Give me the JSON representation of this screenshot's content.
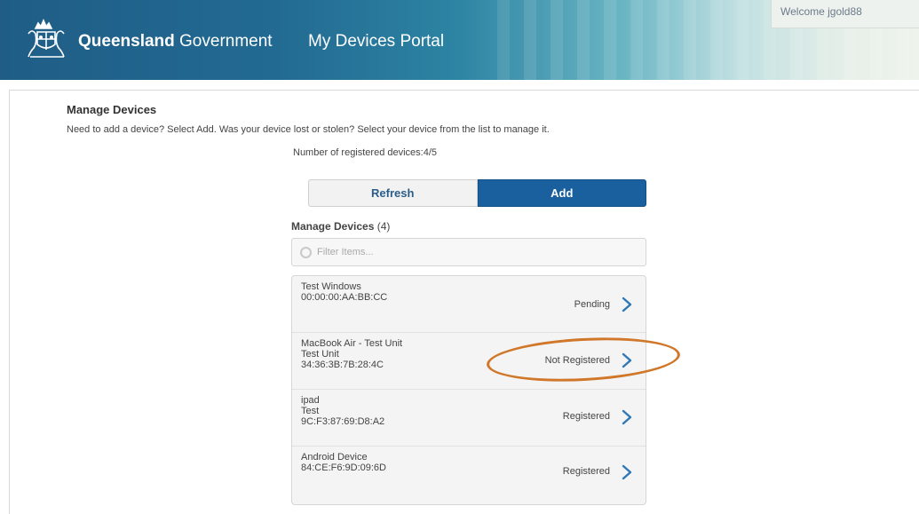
{
  "header": {
    "brand_bold": "Queensland",
    "brand_light": "Government",
    "portal_title": "My Devices Portal",
    "welcome": "Welcome jgold88"
  },
  "main": {
    "title": "Manage Devices",
    "instructions": "Need to add a device? Select Add. Was your device lost or stolen? Select your device from the list to manage it.",
    "registered_count": "Number of registered devices:4/5",
    "refresh_label": "Refresh",
    "add_label": "Add",
    "list_title": "Manage Devices",
    "list_count": "(4)",
    "filter_placeholder": "Filter Items..."
  },
  "devices": [
    {
      "lines": [
        "Test Windows",
        "00:00:00:AA:BB:CC"
      ],
      "status": "Pending"
    },
    {
      "lines": [
        "MacBook Air - Test Unit",
        "Test Unit",
        "34:36:3B:7B:28:4C"
      ],
      "status": "Not Registered"
    },
    {
      "lines": [
        "ipad",
        "Test",
        "9C:F3:87:69:D8:A2"
      ],
      "status": "Registered"
    },
    {
      "lines": [
        "Android Device",
        "84:CE:F6:9D:09:6D"
      ],
      "status": "Registered"
    }
  ],
  "colors": {
    "accent": "#1a5f9e",
    "chevron": "#2f78b8",
    "highlight": "#d0772a"
  },
  "icons": {
    "crest": "queensland-crest-icon",
    "filter": "search-icon",
    "chevron": "chevron-right-icon"
  }
}
